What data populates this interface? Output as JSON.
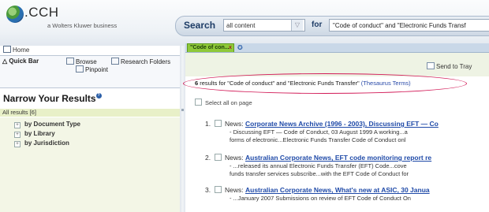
{
  "header": {
    "logo_text": ".CCH",
    "logo_sub": "a Wolters Kluwer business",
    "search_label": "Search",
    "scope_value": "all content",
    "for_label": "for",
    "query_value": "\"Code of conduct\" and \"Electronic Funds Transf"
  },
  "left": {
    "home": "Home",
    "tabs": {
      "quick_bar": "Quick Bar",
      "browse": "Browse",
      "research_folders": "Research Folders",
      "pinpoint": "Pinpoint"
    },
    "narrow_title": "Narrow Your Results",
    "all_results": "All results [6]",
    "facets": [
      "by Document Type",
      "by Library",
      "by Jurisdiction"
    ]
  },
  "right": {
    "doc_tab": "\"Code of con...",
    "send_to_tray": "Send to Tray",
    "summary": {
      "count": "6",
      "text": "results for \"Code of conduct\" and \"Electronic Funds Transfer\"",
      "thesaurus": "(Thesaurus Terms)"
    },
    "select_all": "Select all on page",
    "results": [
      {
        "num": "1.",
        "source": "News:",
        "title": "Corporate News Archive (1996 - 2003), Discussing EFT — Co",
        "snippet1": "- Discussing EFT — Code of Conduct, 03 August 1999 A working...a",
        "snippet2": "forms of electronic...Electronic Funds Transfer Code of Conduct onl"
      },
      {
        "num": "2.",
        "source": "News:",
        "title": "Australian Corporate News, EFT code monitoring report re",
        "snippet1": "- ...released its annual Electronic Funds Transfer (EFT) Code...cove",
        "snippet2": "funds transfer services subscribe...with the EFT Code of Conduct for"
      },
      {
        "num": "3.",
        "source": "News:",
        "title": "Australian Corporate News, What's new at ASIC, 30 Janua",
        "snippet1": "- ...January 2007 Submissions on review of EFT Code of Conduct On",
        "snippet2": ""
      }
    ]
  }
}
